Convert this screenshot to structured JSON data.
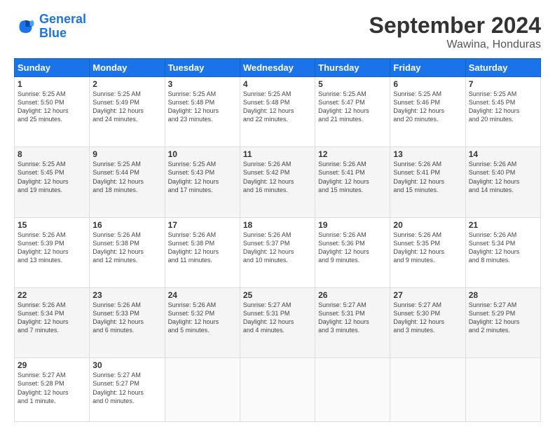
{
  "logo": {
    "line1": "General",
    "line2": "Blue"
  },
  "title": "September 2024",
  "subtitle": "Wawina, Honduras",
  "headers": [
    "Sunday",
    "Monday",
    "Tuesday",
    "Wednesday",
    "Thursday",
    "Friday",
    "Saturday"
  ],
  "weeks": [
    [
      {
        "day": "1",
        "info": "Sunrise: 5:25 AM\nSunset: 5:50 PM\nDaylight: 12 hours\nand 25 minutes."
      },
      {
        "day": "2",
        "info": "Sunrise: 5:25 AM\nSunset: 5:49 PM\nDaylight: 12 hours\nand 24 minutes."
      },
      {
        "day": "3",
        "info": "Sunrise: 5:25 AM\nSunset: 5:48 PM\nDaylight: 12 hours\nand 23 minutes."
      },
      {
        "day": "4",
        "info": "Sunrise: 5:25 AM\nSunset: 5:48 PM\nDaylight: 12 hours\nand 22 minutes."
      },
      {
        "day": "5",
        "info": "Sunrise: 5:25 AM\nSunset: 5:47 PM\nDaylight: 12 hours\nand 21 minutes."
      },
      {
        "day": "6",
        "info": "Sunrise: 5:25 AM\nSunset: 5:46 PM\nDaylight: 12 hours\nand 20 minutes."
      },
      {
        "day": "7",
        "info": "Sunrise: 5:25 AM\nSunset: 5:45 PM\nDaylight: 12 hours\nand 20 minutes."
      }
    ],
    [
      {
        "day": "8",
        "info": "Sunrise: 5:25 AM\nSunset: 5:45 PM\nDaylight: 12 hours\nand 19 minutes."
      },
      {
        "day": "9",
        "info": "Sunrise: 5:25 AM\nSunset: 5:44 PM\nDaylight: 12 hours\nand 18 minutes."
      },
      {
        "day": "10",
        "info": "Sunrise: 5:25 AM\nSunset: 5:43 PM\nDaylight: 12 hours\nand 17 minutes."
      },
      {
        "day": "11",
        "info": "Sunrise: 5:26 AM\nSunset: 5:42 PM\nDaylight: 12 hours\nand 16 minutes."
      },
      {
        "day": "12",
        "info": "Sunrise: 5:26 AM\nSunset: 5:41 PM\nDaylight: 12 hours\nand 15 minutes."
      },
      {
        "day": "13",
        "info": "Sunrise: 5:26 AM\nSunset: 5:41 PM\nDaylight: 12 hours\nand 15 minutes."
      },
      {
        "day": "14",
        "info": "Sunrise: 5:26 AM\nSunset: 5:40 PM\nDaylight: 12 hours\nand 14 minutes."
      }
    ],
    [
      {
        "day": "15",
        "info": "Sunrise: 5:26 AM\nSunset: 5:39 PM\nDaylight: 12 hours\nand 13 minutes."
      },
      {
        "day": "16",
        "info": "Sunrise: 5:26 AM\nSunset: 5:38 PM\nDaylight: 12 hours\nand 12 minutes."
      },
      {
        "day": "17",
        "info": "Sunrise: 5:26 AM\nSunset: 5:38 PM\nDaylight: 12 hours\nand 11 minutes."
      },
      {
        "day": "18",
        "info": "Sunrise: 5:26 AM\nSunset: 5:37 PM\nDaylight: 12 hours\nand 10 minutes."
      },
      {
        "day": "19",
        "info": "Sunrise: 5:26 AM\nSunset: 5:36 PM\nDaylight: 12 hours\nand 9 minutes."
      },
      {
        "day": "20",
        "info": "Sunrise: 5:26 AM\nSunset: 5:35 PM\nDaylight: 12 hours\nand 9 minutes."
      },
      {
        "day": "21",
        "info": "Sunrise: 5:26 AM\nSunset: 5:34 PM\nDaylight: 12 hours\nand 8 minutes."
      }
    ],
    [
      {
        "day": "22",
        "info": "Sunrise: 5:26 AM\nSunset: 5:34 PM\nDaylight: 12 hours\nand 7 minutes."
      },
      {
        "day": "23",
        "info": "Sunrise: 5:26 AM\nSunset: 5:33 PM\nDaylight: 12 hours\nand 6 minutes."
      },
      {
        "day": "24",
        "info": "Sunrise: 5:26 AM\nSunset: 5:32 PM\nDaylight: 12 hours\nand 5 minutes."
      },
      {
        "day": "25",
        "info": "Sunrise: 5:27 AM\nSunset: 5:31 PM\nDaylight: 12 hours\nand 4 minutes."
      },
      {
        "day": "26",
        "info": "Sunrise: 5:27 AM\nSunset: 5:31 PM\nDaylight: 12 hours\nand 3 minutes."
      },
      {
        "day": "27",
        "info": "Sunrise: 5:27 AM\nSunset: 5:30 PM\nDaylight: 12 hours\nand 3 minutes."
      },
      {
        "day": "28",
        "info": "Sunrise: 5:27 AM\nSunset: 5:29 PM\nDaylight: 12 hours\nand 2 minutes."
      }
    ],
    [
      {
        "day": "29",
        "info": "Sunrise: 5:27 AM\nSunset: 5:28 PM\nDaylight: 12 hours\nand 1 minute."
      },
      {
        "day": "30",
        "info": "Sunrise: 5:27 AM\nSunset: 5:27 PM\nDaylight: 12 hours\nand 0 minutes."
      },
      {
        "day": "",
        "info": ""
      },
      {
        "day": "",
        "info": ""
      },
      {
        "day": "",
        "info": ""
      },
      {
        "day": "",
        "info": ""
      },
      {
        "day": "",
        "info": ""
      }
    ]
  ]
}
